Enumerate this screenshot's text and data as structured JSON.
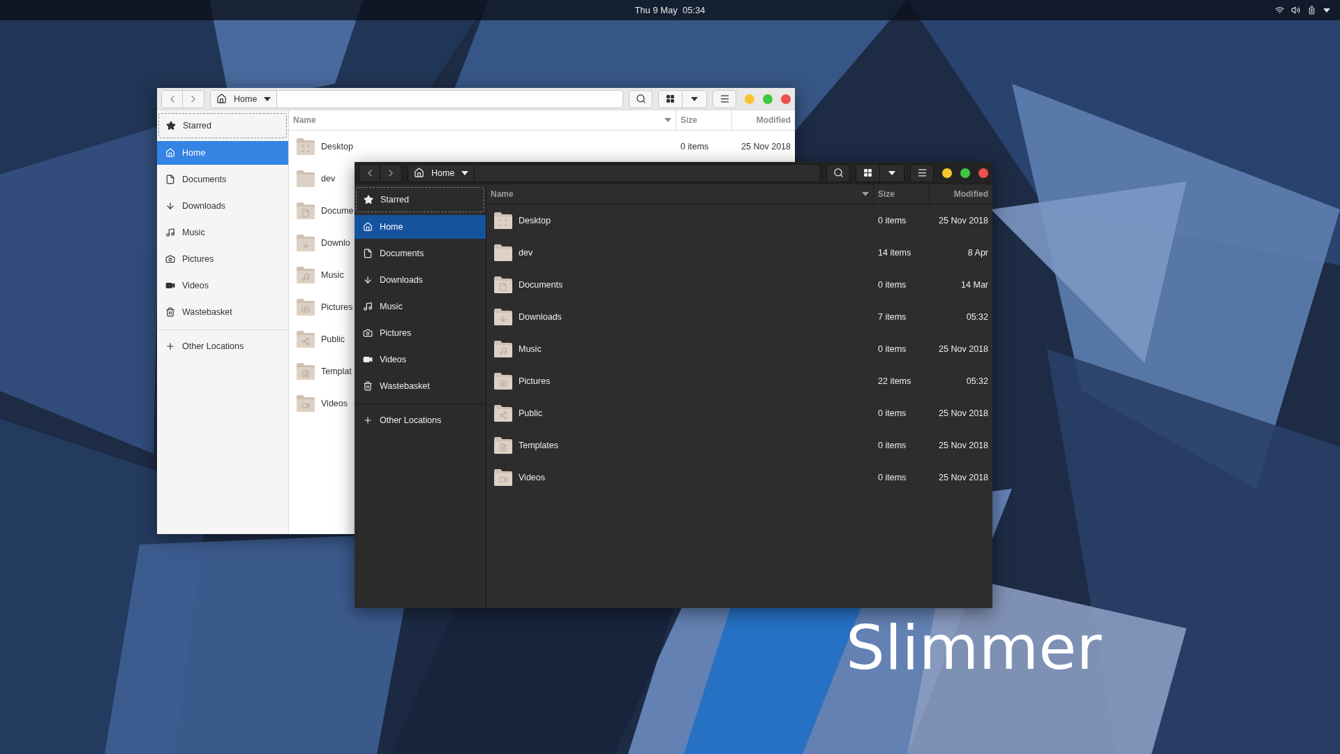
{
  "top_bar": {
    "clock": "Thu 9 May  05:34"
  },
  "windows": [
    {
      "kind": "light",
      "location": "Home",
      "sidebar": {
        "places": [
          {
            "label": "Starred",
            "kind": "star",
            "selected": false,
            "focused": true
          },
          {
            "label": "Home",
            "kind": "home",
            "selected": true,
            "focused": false
          },
          {
            "label": "Documents",
            "kind": "document",
            "selected": false,
            "focused": false
          },
          {
            "label": "Downloads",
            "kind": "download",
            "selected": false,
            "focused": false
          },
          {
            "label": "Music",
            "kind": "music",
            "selected": false,
            "focused": false
          },
          {
            "label": "Pictures",
            "kind": "camera",
            "selected": false,
            "focused": false
          },
          {
            "label": "Videos",
            "kind": "video",
            "selected": false,
            "focused": false
          },
          {
            "label": "Wastebasket",
            "kind": "trash",
            "selected": false,
            "focused": false
          }
        ],
        "other_locations": "Other Locations"
      },
      "columns": [
        "Name",
        "Size",
        "Modified"
      ],
      "rows": [
        {
          "name": "Desktop",
          "kind": "desktop",
          "size": "0 items",
          "modified": "25 Nov 2018"
        },
        {
          "name": "dev",
          "kind": "none"
        },
        {
          "name": "Docume",
          "kind": "document"
        },
        {
          "name": "Downlo",
          "kind": "download"
        },
        {
          "name": "Music",
          "kind": "music"
        },
        {
          "name": "Pictures",
          "kind": "camera"
        },
        {
          "name": "Public",
          "kind": "share"
        },
        {
          "name": "Templat",
          "kind": "template"
        },
        {
          "name": "Videos",
          "kind": "video"
        }
      ]
    },
    {
      "kind": "dark",
      "location": "Home",
      "sidebar": {
        "places": [
          {
            "label": "Starred",
            "kind": "star",
            "selected": false,
            "focused": true
          },
          {
            "label": "Home",
            "kind": "home",
            "selected": true,
            "focused": false
          },
          {
            "label": "Documents",
            "kind": "document",
            "selected": false,
            "focused": false
          },
          {
            "label": "Downloads",
            "kind": "download",
            "selected": false,
            "focused": false
          },
          {
            "label": "Music",
            "kind": "music",
            "selected": false,
            "focused": false
          },
          {
            "label": "Pictures",
            "kind": "camera",
            "selected": false,
            "focused": false
          },
          {
            "label": "Videos",
            "kind": "video",
            "selected": false,
            "focused": false
          },
          {
            "label": "Wastebasket",
            "kind": "trash",
            "selected": false,
            "focused": false
          }
        ],
        "other_locations": "Other Locations"
      },
      "columns": [
        "Name",
        "Size",
        "Modified"
      ],
      "rows": [
        {
          "name": "Desktop",
          "kind": "desktop",
          "size": "0 items",
          "modified": "25 Nov 2018"
        },
        {
          "name": "dev",
          "kind": "none",
          "size": "14 items",
          "modified": "8 Apr"
        },
        {
          "name": "Documents",
          "kind": "document",
          "size": "0 items",
          "modified": "14 Mar"
        },
        {
          "name": "Downloads",
          "kind": "download",
          "size": "7 items",
          "modified": "05:32"
        },
        {
          "name": "Music",
          "kind": "music",
          "size": "0 items",
          "modified": "25 Nov 2018"
        },
        {
          "name": "Pictures",
          "kind": "camera",
          "size": "22 items",
          "modified": "05:32"
        },
        {
          "name": "Public",
          "kind": "share",
          "size": "0 items",
          "modified": "25 Nov 2018"
        },
        {
          "name": "Templates",
          "kind": "template",
          "size": "0 items",
          "modified": "25 Nov 2018"
        },
        {
          "name": "Videos",
          "kind": "video",
          "size": "0 items",
          "modified": "25 Nov 2018"
        }
      ]
    }
  ],
  "caption": "Slimmer"
}
